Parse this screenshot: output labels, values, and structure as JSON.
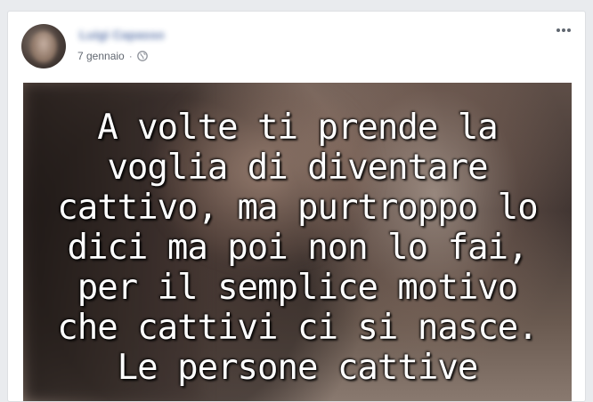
{
  "post": {
    "author_name": "Luigi Capasso",
    "date": "7 gennaio",
    "separator": "·",
    "privacy_icon": "globe-icon",
    "more_icon": "more-options-icon"
  },
  "image": {
    "quote_lines": [
      "A volte ti prende la",
      "voglia di diventare",
      "cattivo, ma purtroppo lo",
      "dici ma poi non lo fai,",
      "per il semplice motivo",
      "che cattivi ci si nasce.",
      "Le persone cattive"
    ]
  },
  "colors": {
    "background": "#e9ebee",
    "card": "#ffffff",
    "author_link": "#4b67a1",
    "meta_text": "#616770"
  }
}
